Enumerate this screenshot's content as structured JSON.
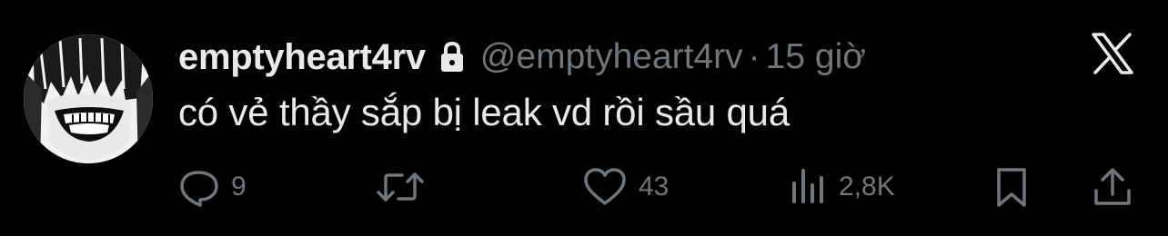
{
  "tweet": {
    "display_name": "emptyheart4rv",
    "handle": "@emptyheart4rv",
    "separator": "·",
    "time": "15 giờ",
    "text": "có vẻ thầy sắp bị leak vd rồi sầu quá",
    "protected_icon": "lock-icon",
    "platform_icon": "x-logo-icon"
  },
  "actions": {
    "reply_count": "9",
    "retweet_count": "",
    "like_count": "43",
    "view_count": "2,8K"
  },
  "colors": {
    "background": "#000000",
    "primary_text": "#e7e9ea",
    "secondary_text": "#71767b"
  }
}
